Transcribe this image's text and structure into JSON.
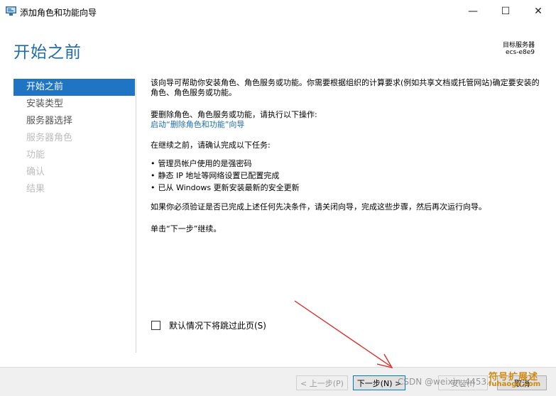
{
  "window": {
    "title": "添加角色和功能向导",
    "minimize_glyph": "—",
    "maximize_glyph": "☐",
    "close_glyph": "✕"
  },
  "header": {
    "page_title": "开始之前",
    "target_server_label": "目标服务器",
    "target_server_name": "ecs-e8e9"
  },
  "nav": {
    "items": [
      {
        "label": "开始之前",
        "state": "active"
      },
      {
        "label": "安装类型",
        "state": "enabled"
      },
      {
        "label": "服务器选择",
        "state": "enabled"
      },
      {
        "label": "服务器角色",
        "state": "disabled"
      },
      {
        "label": "功能",
        "state": "disabled"
      },
      {
        "label": "确认",
        "state": "disabled"
      },
      {
        "label": "结果",
        "state": "disabled"
      }
    ]
  },
  "main": {
    "intro": "该向导可帮助你安装角色、角色服务或功能。你需要根据组织的计算要求(例如共享文档或托管网站)确定要安装的角色、角色服务或功能。",
    "remove_text": "要删除角色、角色服务或功能，请执行以下操作:",
    "remove_link": "启动“删除角色和功能”向导",
    "confirm_text": "在继续之前，请确认完成以下任务:",
    "tasks": [
      "管理员帐户使用的是强密码",
      "静态 IP 地址等网络设置已配置完成",
      "已从 Windows 更新安装最新的安全更新"
    ],
    "verify_text": "如果你必须验证是否已完成上述任何先决条件，请关闭向导，完成这些步骤，然后再次运行向导。",
    "next_hint": "单击“下一步”继续。"
  },
  "skip_checkbox": {
    "label": "默认情况下将跳过此页(S)",
    "checked": false
  },
  "footer": {
    "prev_label": "< 上一步(P)",
    "next_label": "下一步(N) >",
    "install_label": "安装(I)",
    "cancel_label": "取消"
  },
  "watermarks": {
    "csdn": "CSDN @weixin_4453...",
    "brand": "符号扩展述",
    "domain": "fuhaoge.com"
  },
  "colors": {
    "title_blue": "#1f6ca8",
    "nav_active_bg": "#1f74c4",
    "annotation_arrow": "#e02020"
  }
}
